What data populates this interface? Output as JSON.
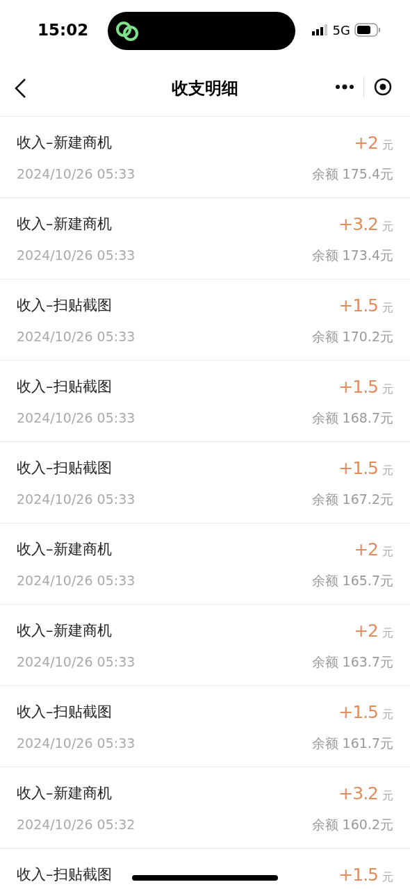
{
  "status_bar": {
    "time": "15:02",
    "network": "5G"
  },
  "nav": {
    "title": "收支明细"
  },
  "records": [
    {
      "title": "收入–新建商机",
      "amount": "+2",
      "unit": "元",
      "time": "2024/10/26 05:33",
      "balance": "余额 175.4元"
    },
    {
      "title": "收入–新建商机",
      "amount": "+3.2",
      "unit": "元",
      "time": "2024/10/26 05:33",
      "balance": "余额 173.4元"
    },
    {
      "title": "收入–扫贴截图",
      "amount": "+1.5",
      "unit": "元",
      "time": "2024/10/26 05:33",
      "balance": "余额 170.2元"
    },
    {
      "title": "收入–扫贴截图",
      "amount": "+1.5",
      "unit": "元",
      "time": "2024/10/26 05:33",
      "balance": "余额 168.7元"
    },
    {
      "title": "收入–扫贴截图",
      "amount": "+1.5",
      "unit": "元",
      "time": "2024/10/26 05:33",
      "balance": "余额 167.2元"
    },
    {
      "title": "收入–新建商机",
      "amount": "+2",
      "unit": "元",
      "time": "2024/10/26 05:33",
      "balance": "余额 165.7元"
    },
    {
      "title": "收入–新建商机",
      "amount": "+2",
      "unit": "元",
      "time": "2024/10/26 05:33",
      "balance": "余额 163.7元"
    },
    {
      "title": "收入–扫贴截图",
      "amount": "+1.5",
      "unit": "元",
      "time": "2024/10/26 05:33",
      "balance": "余额 161.7元"
    },
    {
      "title": "收入–新建商机",
      "amount": "+3.2",
      "unit": "元",
      "time": "2024/10/26 05:32",
      "balance": "余额 160.2元"
    },
    {
      "title": "收入–扫贴截图",
      "amount": "+1.5",
      "unit": "元"
    }
  ]
}
